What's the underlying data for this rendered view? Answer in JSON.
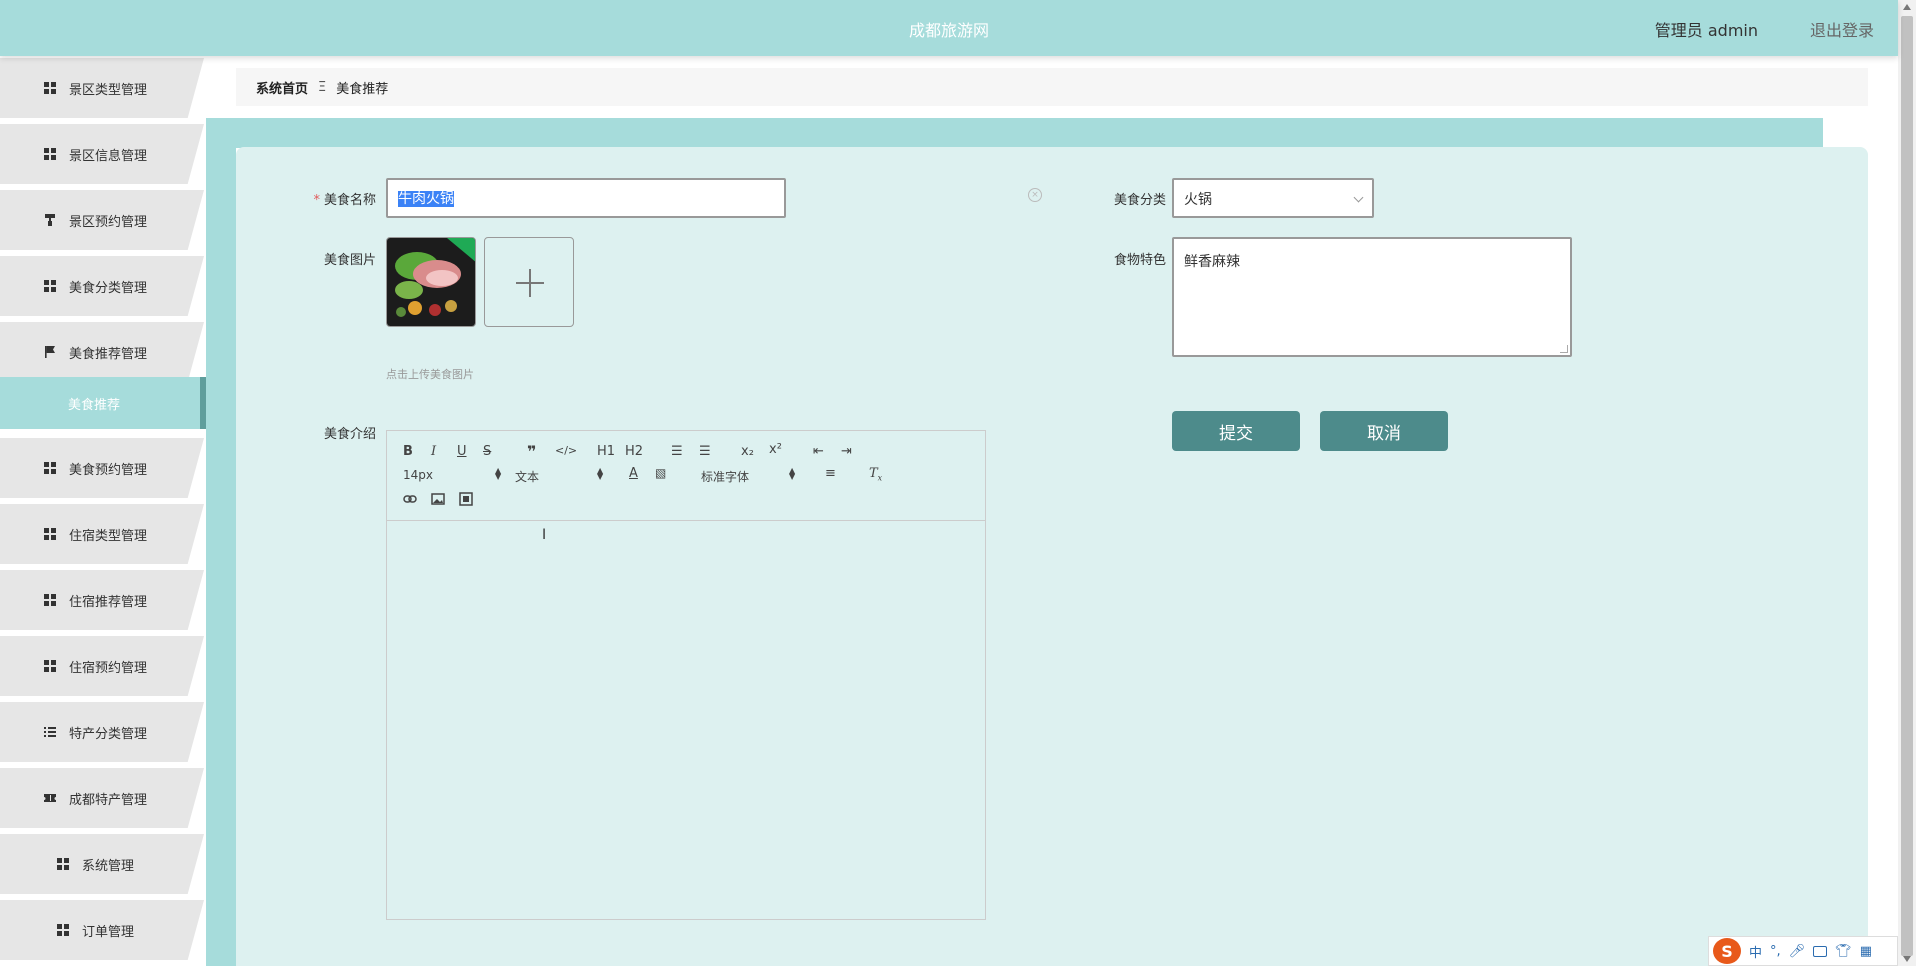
{
  "header": {
    "title": "成都旅游网",
    "user_label": "管理员 admin",
    "logout_label": "退出登录"
  },
  "sidebar": {
    "items": [
      {
        "label": "景区类型管理",
        "icon": "grid-icon"
      },
      {
        "label": "景区信息管理",
        "icon": "grid-icon"
      },
      {
        "label": "景区预约管理",
        "icon": "paint-roller-icon"
      },
      {
        "label": "美食分类管理",
        "icon": "grid-icon"
      },
      {
        "label": "美食推荐管理",
        "icon": "flag-icon"
      },
      {
        "label": "美食预约管理",
        "icon": "grid-icon"
      },
      {
        "label": "住宿类型管理",
        "icon": "grid-icon"
      },
      {
        "label": "住宿推荐管理",
        "icon": "grid-icon"
      },
      {
        "label": "住宿预约管理",
        "icon": "grid-icon"
      },
      {
        "label": "特产分类管理",
        "icon": "list-icon"
      },
      {
        "label": "成都特产管理",
        "icon": "ticket-icon"
      },
      {
        "label": "系统管理",
        "icon": "grid-icon"
      },
      {
        "label": "订单管理",
        "icon": "grid-icon"
      }
    ],
    "active_sub": "美食推荐"
  },
  "breadcrumb": {
    "home": "系统首页",
    "separator": "Ξ",
    "current": "美食推荐"
  },
  "form": {
    "name_label": "美食名称",
    "name_required_mark": "*",
    "name_value": "牛肉火锅",
    "image_label": "美食图片",
    "upload_hint": "点击上传美食图片",
    "category_label": "美食分类",
    "category_value": "火锅",
    "feature_label": "食物特色",
    "feature_value": "鲜香麻辣",
    "intro_label": "美食介绍",
    "submit_label": "提交",
    "cancel_label": "取消"
  },
  "editor": {
    "font_size": "14px",
    "header_select": "文本",
    "font_family": "标准字体",
    "h1": "H1",
    "h2": "H2"
  },
  "ime": {
    "logo": "S",
    "mode": "中"
  },
  "colors": {
    "header_bg": "#a6dcdb",
    "panel_bg": "#ddf1f0",
    "button_bg": "#4d8b8b",
    "sidebar_item_bg": "#e6e6e6"
  }
}
